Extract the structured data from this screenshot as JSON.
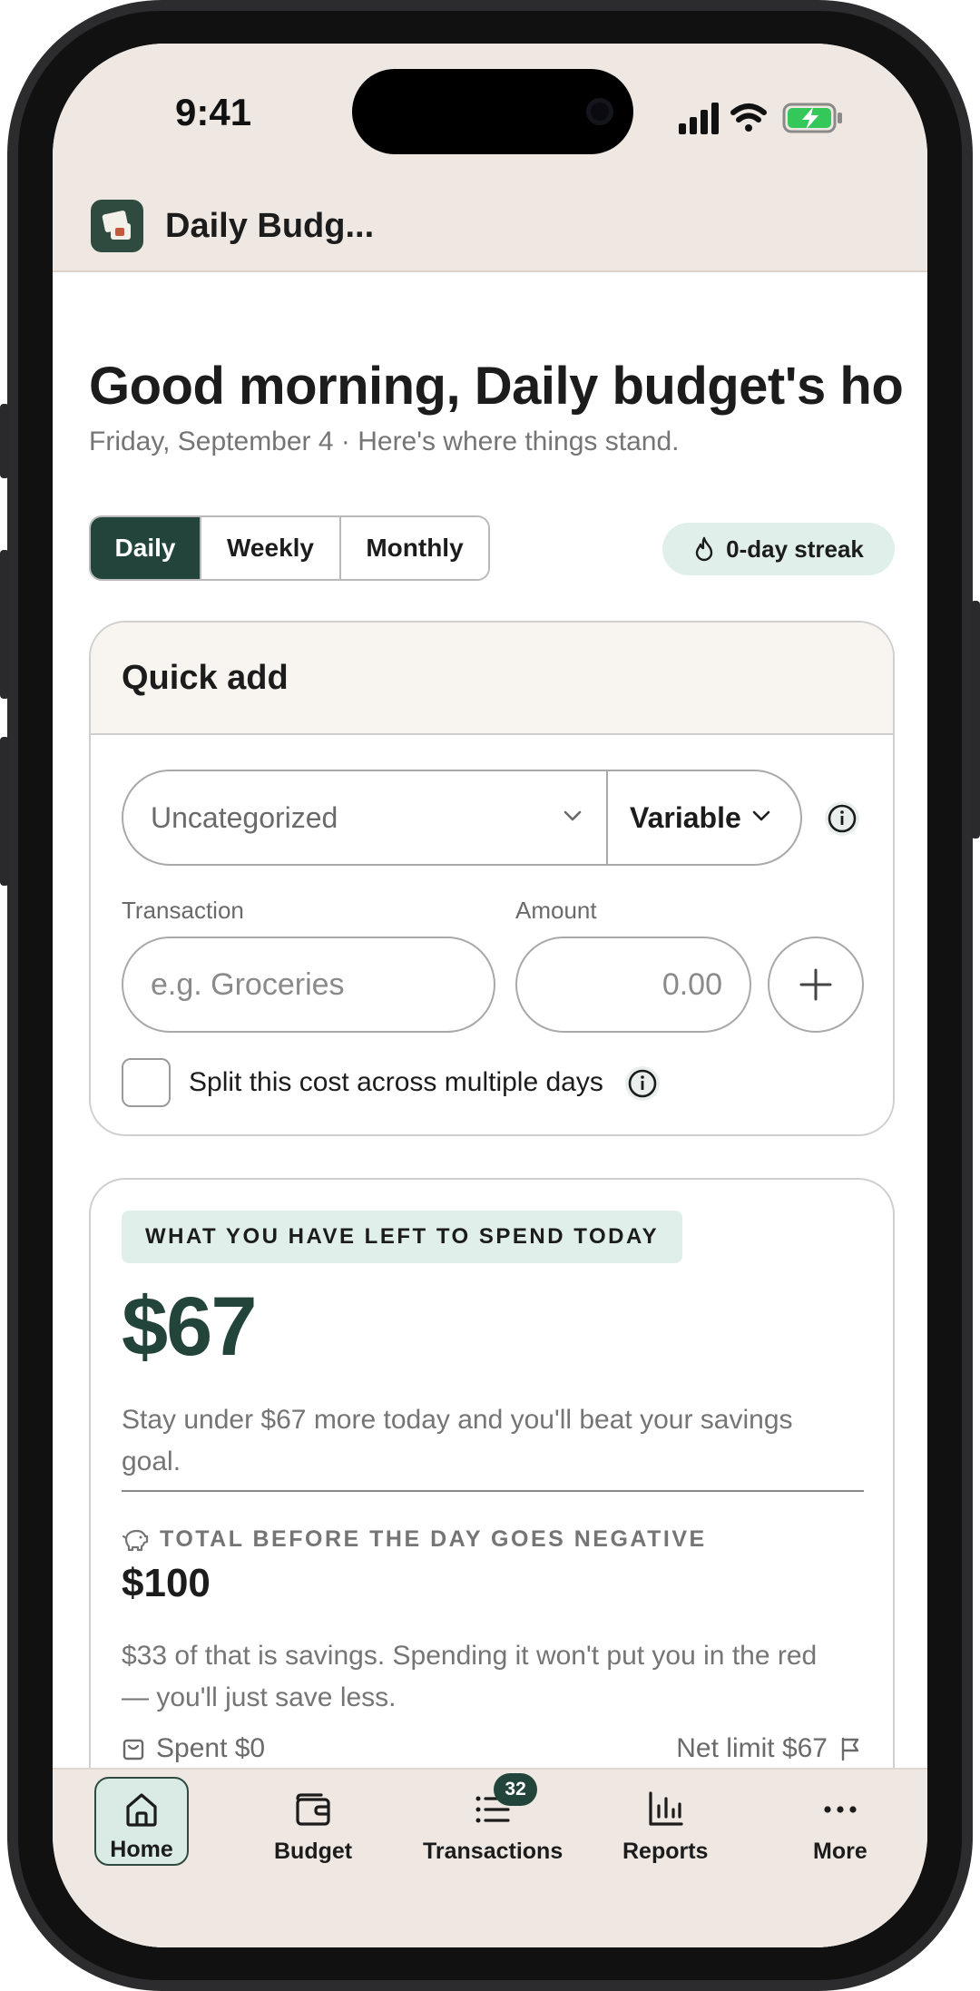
{
  "status_bar": {
    "time": "9:41"
  },
  "app": {
    "title": "Daily Budg..."
  },
  "header": {
    "greeting": "Good morning, Daily budget's ho...",
    "subtitle": "Friday, September 4 · Here's where things stand."
  },
  "period_tabs": [
    {
      "label": "Daily",
      "active": true
    },
    {
      "label": "Weekly",
      "active": false
    },
    {
      "label": "Monthly",
      "active": false
    }
  ],
  "streak": {
    "label": "0-day streak",
    "icon": "flame-icon"
  },
  "quick_add": {
    "title": "Quick add",
    "category": {
      "value": "Uncategorized"
    },
    "cost_type": {
      "value": "Variable"
    },
    "transaction": {
      "label": "Transaction",
      "placeholder": "e.g. Groceries"
    },
    "amount": {
      "label": "Amount",
      "placeholder": "0.00"
    },
    "split": {
      "label": "Split this cost across multiple days",
      "checked": false
    }
  },
  "spend_today": {
    "tag": "WHAT YOU HAVE LEFT TO SPEND TODAY",
    "amount": "$67",
    "description": "Stay under $67 more today and you'll beat your savings goal.",
    "total_heading": "TOTAL BEFORE THE DAY GOES NEGATIVE",
    "total_amount": "$100",
    "total_description": "$33 of that is savings. Spending it won't put you in the red — you'll just save less.",
    "spent_label": "Spent $0",
    "net_limit_label": "Net limit $67",
    "spent_fraction": 0
  },
  "bottom_nav": [
    {
      "label": "Home",
      "icon": "home-icon",
      "active": true
    },
    {
      "label": "Budget",
      "icon": "wallet-icon",
      "active": false
    },
    {
      "label": "Transactions",
      "icon": "list-icon",
      "active": false,
      "badge": "32"
    },
    {
      "label": "Reports",
      "icon": "bar-chart-icon",
      "active": false
    },
    {
      "label": "More",
      "icon": "more-icon",
      "active": false
    }
  ],
  "colors": {
    "brand": "#23443a",
    "accent_soft": "#e1efea",
    "header_bg": "#efe8e2",
    "card_head_bg": "#f8f4ef",
    "progress_track": "#e5ddd4"
  }
}
